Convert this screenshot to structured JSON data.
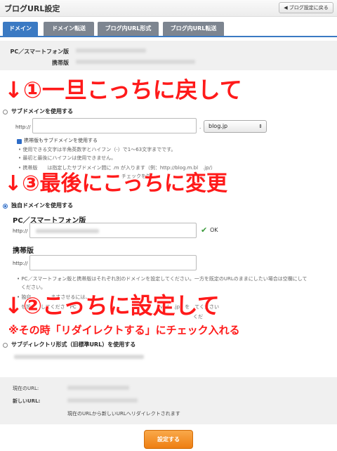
{
  "header": {
    "title": "ブログURL設定",
    "back_button": "◀ ブログ設定に戻る"
  },
  "tabs": [
    {
      "label": "ドメイン",
      "active": true
    },
    {
      "label": "ドメイン転送",
      "active": false
    },
    {
      "label": "ブログ内URL形式",
      "active": false
    },
    {
      "label": "ブログ内URL転送",
      "active": false
    }
  ],
  "current_urls": {
    "pc_label": "PC／スマートフォン版",
    "mobile_label": "携帯版"
  },
  "subdomain": {
    "option_label": "サブドメインを使用する",
    "url_prefix": "http://",
    "dot": ".",
    "domain_select": "blog.jp",
    "mobile_checkbox_label": "携帯版もサブドメインを使用する",
    "notes": [
      "使用できる文字は半角英数字とハイフン（-）で1〜63文字までです。",
      "最初と最後にハイフンは使用できません。",
      "携帯版　　は指定したサブドメイン間に .m が入ります（例：http://blog.m.bl　.jp/）",
      "　　　　　　　　　　　　　　　　　　　　　チェックを外　　　　　　　　　すに"
    ]
  },
  "custom_domain": {
    "option_label": "独自ドメインを使用する",
    "pc_heading": "PC／スマートフォン版",
    "pc_prefix": "http://",
    "ok_label": "OK",
    "mobile_heading": "携帯版",
    "mobile_prefix": "http://",
    "notes": [
      "PC／スマートフォン版と携帯版はそれぞれ別のドメインを設定してください。一方を既定のURLのままにしたい場合は空欄にして",
      "ください。",
      "独自　　　　ますさせるには、　　　　　　　　　　　　　　　　　　　　　　　　　　　　　",
      "を設　　してくださ　PC　　　　　　　　　　　　　　　　　ved　.jp　を　てください",
      "　　　　　　　　　　　　　　　　　　　　　　　　　　　　　　　　　　　くだ"
    ]
  },
  "subdirectory": {
    "option_label": "サブディレクトリ形式（旧標準URL）を使用する"
  },
  "redirect": {
    "current_label": "現在のURL:",
    "new_label": "新しいURL:",
    "message": "現在のURLから新しいURLへリダイレクトされます"
  },
  "submit_label": "設定する",
  "annotations": {
    "step1": "↓①一旦こっちに戻して",
    "step3": "↓③最後にこっちに変更",
    "step2": "↓②こっちに設定して",
    "note": "※その時「リダイレクトする」にチェック入れる",
    "color": "#ff1a1a"
  },
  "colors": {
    "accent": "#3b7ac3",
    "tab_inactive": "#7d8590",
    "ok_green": "#3a9a3a",
    "submit": "#ee7e12"
  }
}
